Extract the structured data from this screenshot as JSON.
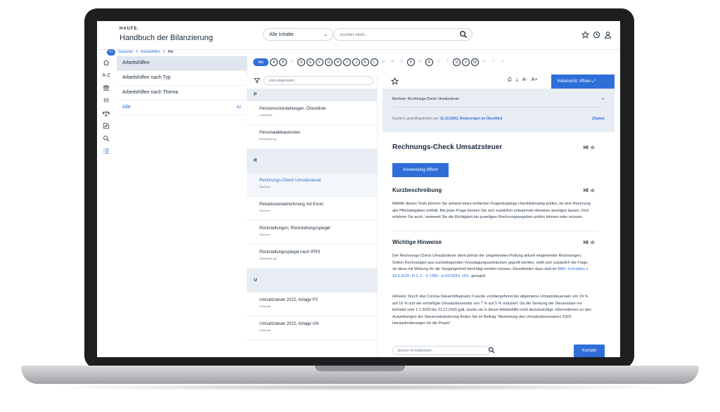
{
  "header": {
    "logo": "HAUFE.",
    "title": "Handbuch der Bilanzierung",
    "filter_value": "Alle Inhalte",
    "search_placeholder": "Suchen nach..."
  },
  "breadcrumb": {
    "back": "<<",
    "items": [
      "Startseite",
      "Arbeitshilfen",
      "Alle"
    ],
    "sep": ">"
  },
  "rail": {
    "labels": [
      "A-Z",
      "§§"
    ]
  },
  "nav": {
    "items": [
      {
        "label": "Arbeitshilfen"
      },
      {
        "label": "Arbeitshilfen nach Typ"
      },
      {
        "label": "Arbeitshilfen nach Thema"
      },
      {
        "label": "Alle",
        "sort": "AZ"
      }
    ]
  },
  "alphabet": {
    "all": "Alle",
    "letters": [
      "A",
      "B",
      "C",
      "D",
      "E",
      "F",
      "G",
      "H",
      "I",
      "J",
      "K",
      "L",
      "M",
      "N",
      "O",
      "P",
      "Q",
      "R",
      "S",
      "T",
      "U",
      "V",
      "W",
      "X",
      "Y",
      "Z"
    ],
    "inactive": [
      "C",
      "M",
      "N",
      "O",
      "Q",
      "S",
      "T",
      "X",
      "Y",
      "Z"
    ]
  },
  "list": {
    "filter_placeholder": "Liste eingrenzen",
    "groups": [
      {
        "letter": "P",
        "items": [
          {
            "title": "Pensionsrückstellungen, Checkliste",
            "type": "Checkliste"
          },
          {
            "title": "Personalabbaukosten",
            "type": "Musterlösung"
          }
        ]
      },
      {
        "letter": "R",
        "items": [
          {
            "title": "Rechnungs-Check Umsatzsteuer",
            "type": "Rechner"
          },
          {
            "title": "Reisekostenabrechnung mit Excel",
            "type": "Rechner"
          },
          {
            "title": "Rückstellungen, Rückstellungsspiegel",
            "type": "Rechner"
          },
          {
            "title": "Rückstellungsspiegel nach IFRS",
            "type": "Musterlösung"
          }
        ]
      },
      {
        "letter": "U",
        "items": [
          {
            "title": "Umsatzsteuer 2022, Anlage FV",
            "type": "Formular"
          },
          {
            "title": "Umsatzsteuer 2022, Anlage UN",
            "type": "Formular"
          }
        ]
      }
    ]
  },
  "doc": {
    "vollansicht": "Vollansicht: öffnen",
    "rechner_line": "Rechner: Rechnungs-Check Umsatzsteuer",
    "fach_label": "Fachlich geprüft/geändert am:",
    "fach_date": "12.10.2020,",
    "fach_link": "Änderungen im Überblick",
    "zitation": "Zitation",
    "title": "Rechnungs-Check Umsatzsteuer",
    "hi": "HI",
    "button": "Anwendung öffnen",
    "kurz_heading": "Kurzbeschreibung",
    "kurz_text": "Mithilfe dieses Tools können Sie anhand eines einfachen Fragenkatalogs checklistenartig prüfen, ob eine Rechnung alle Pflichtangaben enthält. Bei jeder Frage können Sie sich zusätzlich erläuternde Hinweise anzeigen lassen. Dort erfahren Sie auch, inwieweit Sie die Richtigkeit der jeweiligen Rechnungsangaben prüfen können oder müssen.",
    "wichtig_heading": "Wichtige Hinweise",
    "wichtig_text": "Der Rechnungs-Check Umsatzsteuer dient primär der umgehenden Prüfung aktuell eingehender Rechnungen. Sofern Rechnungen aus zurückliegenden Veranlagungszeiträumen geprüft werden, stellt sich zusätzlich die Frage, ob diese mit Wirkung für die Vergangenheit berichtigt werden können. Einzelheiten dazu sind im",
    "wichtig_link": "BMF, Schreiben v. 18.9.2020, III C 2 - S 7286 - a/19/10001 :001",
    "wichtig_end": ", geregelt.",
    "hinweis_text": "Hinweis: Durch das Corona-Steuerhilfegesetz II wurde vorübergehend der allgemeine Umsatzsteuersatz von 19 % auf 16 % und der ermäßigte Umsatzsteuersatz von 7 % auf 5 % reduziert. Da die Senkung der Steuersätze nur befristet vom 1.7.2020 bis 31.12.2020 galt, wurde sie in dieser Arbeitshilfe nicht berücksichtigt. Informationen zu den Auswirkungen der Steuersatzänderung finden Sie im Beitrag \"Absenkung des Umsatzsteuersatzes 2020: Herausforderungen für die Praxis\"",
    "search_placeholder": "Suchen im Dokument...",
    "kontakt": "Kontakt"
  },
  "colors": {
    "accent": "#2f6ed8",
    "panel": "#e8edf4",
    "bezel": "#1d1e20"
  }
}
